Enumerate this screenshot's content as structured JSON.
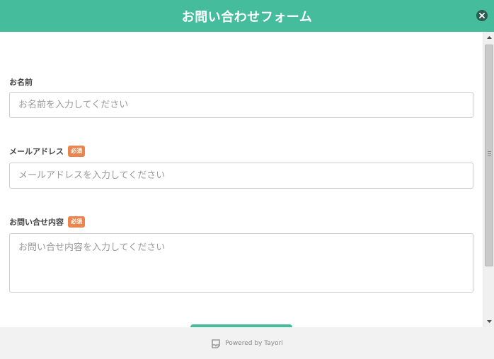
{
  "header": {
    "title": "お問い合わせフォーム"
  },
  "form": {
    "name": {
      "label": "お名前",
      "placeholder": "お名前を入力してください"
    },
    "email": {
      "label": "メールアドレス",
      "required_badge": "必須",
      "placeholder": "メールアドレスを入力してください"
    },
    "message": {
      "label": "お問い合せ内容",
      "required_badge": "必須",
      "placeholder": "お問い合せ内容を入力してください"
    }
  },
  "footer": {
    "powered_by": "Powered by Tayori"
  },
  "colors": {
    "accent": "#45bd9c",
    "badge": "#e9854d",
    "close_button": "#2e5b52"
  },
  "icons": {
    "close": "close-icon",
    "footer_logo": "tayori-logo-icon"
  }
}
